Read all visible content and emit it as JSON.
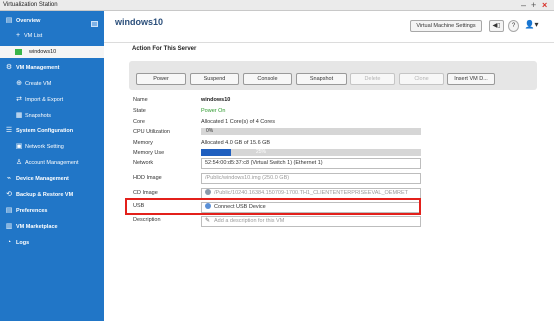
{
  "window": {
    "title": "Virtualization Station"
  },
  "sidebar": {
    "items": [
      {
        "label": "Overview"
      },
      {
        "label": "VM List"
      },
      {
        "label": "windows10"
      },
      {
        "label": "VM Management"
      },
      {
        "label": "Create VM"
      },
      {
        "label": "Import & Export"
      },
      {
        "label": "Snapshots"
      },
      {
        "label": "System Configuration"
      },
      {
        "label": "Network Setting"
      },
      {
        "label": "Account Management"
      },
      {
        "label": "Device Management"
      },
      {
        "label": "Backup & Restore VM"
      },
      {
        "label": "Preferences"
      },
      {
        "label": "VM Marketplace"
      },
      {
        "label": "Logs"
      }
    ]
  },
  "header": {
    "vm_name": "windows10",
    "settings_label": "Virtual Machine Settings",
    "volume_glyph": "◀▯",
    "help_glyph": "?",
    "user_glyph": "👤▾"
  },
  "actions": {
    "title": "Action For This Server",
    "buttons": [
      {
        "label": "Power"
      },
      {
        "label": "Suspend"
      },
      {
        "label": "Console"
      },
      {
        "label": "Snapshot"
      },
      {
        "label": "Delete"
      },
      {
        "label": "Clone"
      },
      {
        "label": "Insert VM D..."
      }
    ]
  },
  "properties": {
    "name_label": "Name",
    "name_value": "windows10",
    "state_label": "State",
    "state_value": "Power On",
    "core_label": "Core",
    "core_value": "Allocated 1 Core(s) of 4 Cores",
    "cpu_label": "CPU Utilization",
    "cpu_value": "0%",
    "memory_label": "Memory",
    "memory_value": "Allocated 4.0 GB of 15.6 GB",
    "memuse_label": "Memory Use",
    "memuse_value": "25%",
    "memuse_fraction": 0.25,
    "network_label": "Network",
    "network_value": "52:54:00:d5:37:c8 (Virtual Switch 1) (Ethernet 1)",
    "hdd_label": "HDD Image",
    "hdd_value": "/Public/windows10.img (250.0 GB)",
    "cd_label": "CD Image",
    "cd_value": "/Public/10240.16384.150709-1700.TH1_CLIENTENTERPRISEEVAL_OEMRET",
    "usb_label": "USB",
    "usb_value": "Connect USB Device",
    "desc_label": "Description",
    "desc_placeholder": "Add a description for this VM"
  },
  "colors": {
    "sidebar": "#2176c7",
    "accent": "#1f5fbf",
    "highlight": "#e3201b",
    "state_on": "#2e9a2e"
  }
}
